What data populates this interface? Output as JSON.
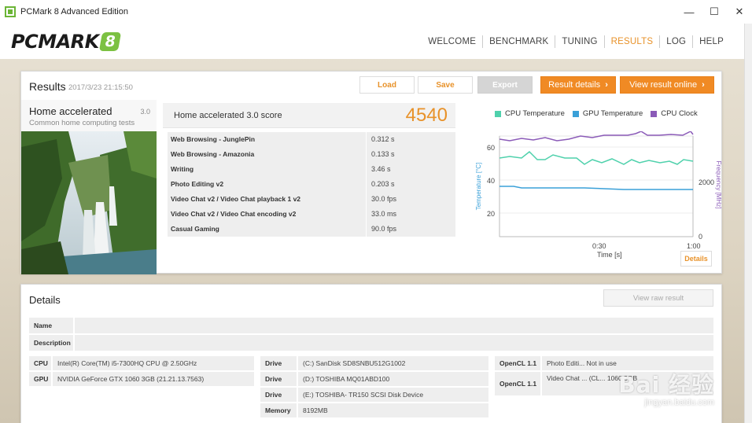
{
  "window": {
    "title": "PCMark 8 Advanced Edition",
    "minimize": "—",
    "maximize": "☐",
    "close": "✕"
  },
  "header": {
    "logo_text": "PCMARK",
    "logo_number": "8",
    "nav": [
      {
        "label": "WELCOME",
        "active": false
      },
      {
        "label": "BENCHMARK",
        "active": false
      },
      {
        "label": "TUNING",
        "active": false
      },
      {
        "label": "RESULTS",
        "active": true
      },
      {
        "label": "LOG",
        "active": false
      },
      {
        "label": "HELP",
        "active": false
      }
    ]
  },
  "results": {
    "title": "Results",
    "date": "2017/3/23 21:15:50",
    "buttons": {
      "load": "Load",
      "save": "Save",
      "export": "Export",
      "result_details": "Result details",
      "view_online": "View result online"
    },
    "test": {
      "name": "Home accelerated",
      "version": "3.0",
      "description": "Common home computing tests"
    },
    "score_label": "Home accelerated 3.0 score",
    "score": "4540",
    "subscores": [
      {
        "name": "Web Browsing - JunglePin",
        "value": "0.312 s"
      },
      {
        "name": "Web Browsing - Amazonia",
        "value": "0.133 s"
      },
      {
        "name": "Writing",
        "value": "3.46 s"
      },
      {
        "name": "Photo Editing v2",
        "value": "0.203 s"
      },
      {
        "name": "Video Chat v2 / Video Chat playback 1 v2",
        "value": "30.0 fps"
      },
      {
        "name": "Video Chat v2 / Video Chat encoding v2",
        "value": "33.0 ms"
      },
      {
        "name": "Casual Gaming",
        "value": "90.0 fps"
      }
    ],
    "graph": {
      "legend": [
        {
          "name": "CPU Temperature",
          "color": "#4fd1ac"
        },
        {
          "name": "GPU Temperature",
          "color": "#3aa0d8"
        },
        {
          "name": "CPU Clock",
          "color": "#8b5bb8"
        }
      ],
      "left_axis_label": "Temperature [°C]",
      "right_axis_label": "Frequency [MHz]",
      "x_axis_label": "Time [s]",
      "left_ticks": [
        "60",
        "40",
        "20"
      ],
      "right_ticks": [
        "2000",
        "0"
      ],
      "x_ticks": [
        "0:30",
        "1:00"
      ],
      "details_button": "Details"
    }
  },
  "details": {
    "title": "Details",
    "raw_button": "View raw result",
    "name_label": "Name",
    "description_label": "Description",
    "cpu_label": "CPU",
    "cpu_value": "Intel(R) Core(TM) i5-7300HQ CPU @ 2.50GHz",
    "gpu_label": "GPU",
    "gpu_value": "NVIDIA GeForce GTX 1060 3GB (21.21.13.7563)",
    "drive_label": "Drive",
    "drives": [
      "(C:) SanDisk SD8SNBU512G1002",
      "(D:) TOSHIBA MQ01ABD100",
      "(E:) TOSHIBA- TR150 SCSI Disk Device"
    ],
    "memory_label": "Memory",
    "memory_value": "8192MB",
    "opencl_label": "OpenCL 1.1",
    "opencl_values": [
      "Photo Editi... Not in use",
      "Video Chat ... (CL... 1060 3GB"
    ]
  },
  "watermark": {
    "main": "Bai 经验",
    "url": "jingyan.baidu.com"
  }
}
